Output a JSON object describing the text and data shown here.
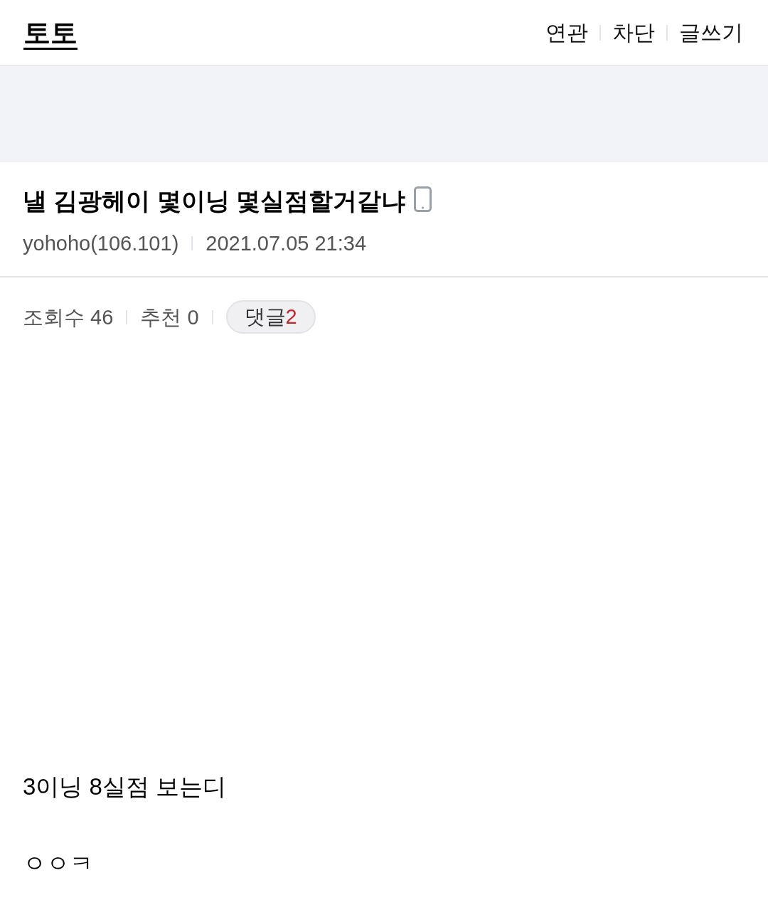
{
  "header": {
    "logo": "토토",
    "links": [
      "연관",
      "차단",
      "글쓰기"
    ]
  },
  "post": {
    "title": "낼 김광헤이 몇이닝 몇실점할거같냐",
    "author": "yohoho(106.101)",
    "date": "2021.07.05 21:34"
  },
  "stats": [
    "조회수 46",
    "추천 0"
  ],
  "comments": {
    "label": "댓글",
    "count": "2"
  },
  "body": [
    "3이닝 8실점 보는디",
    "ㅇㅇㅋ"
  ]
}
